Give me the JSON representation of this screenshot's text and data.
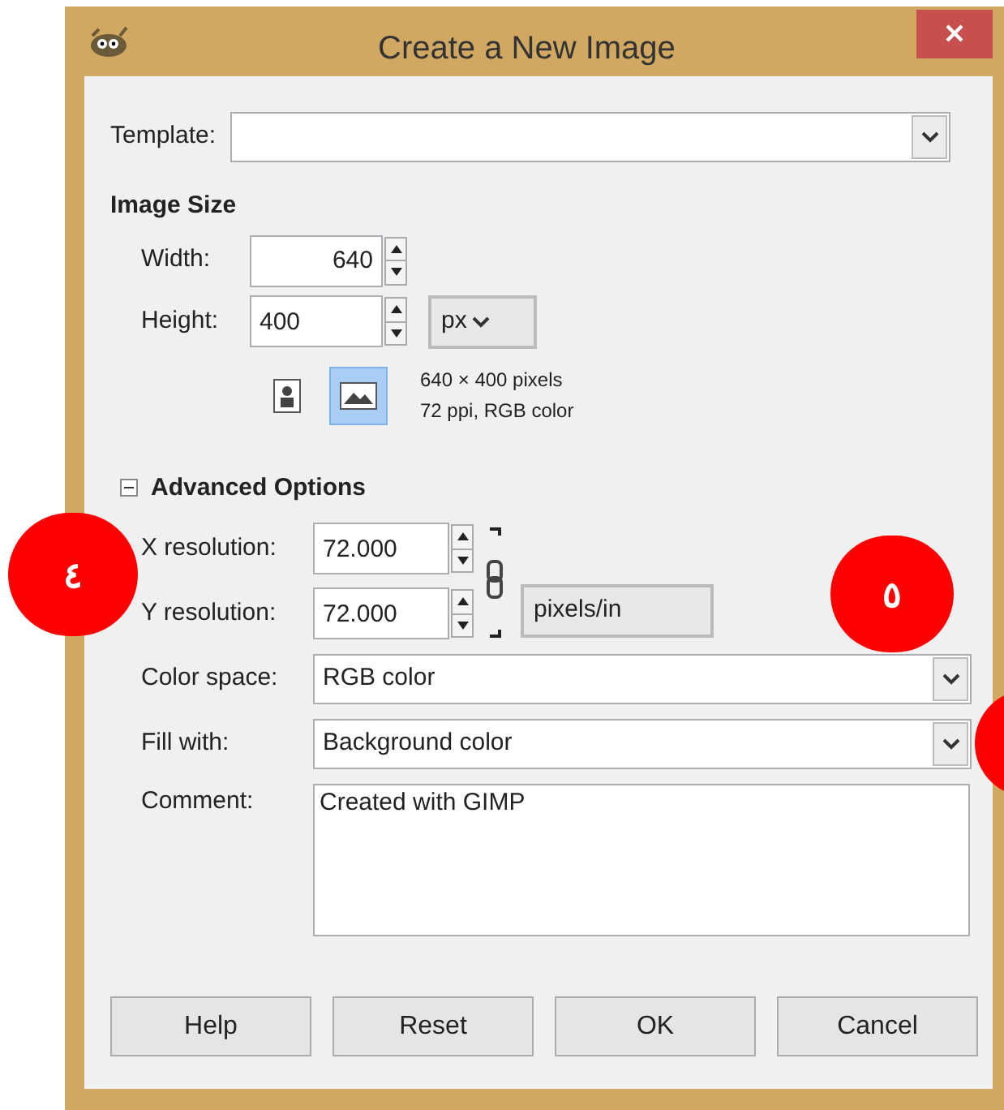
{
  "window": {
    "title": "Create a New Image"
  },
  "template": {
    "label": "Template:"
  },
  "image_size": {
    "heading": "Image Size",
    "width": {
      "label": "Width:",
      "value": "640"
    },
    "height": {
      "label": "Height:",
      "value": "400"
    },
    "unit": "px",
    "orientations": [
      {
        "kind": "portrait",
        "selected": false
      },
      {
        "kind": "landscape",
        "selected": true
      }
    ],
    "info": [
      "640 × 400 pixels",
      "72 ppi, RGB color"
    ]
  },
  "advanced": {
    "label": "Advanced Options",
    "expanded": true,
    "x_resolution": {
      "label": "X resolution:",
      "value": "72.000"
    },
    "y_resolution": {
      "label": "Y resolution:",
      "value": "72.000"
    },
    "resolution_unit": "pixels/in",
    "color_space": {
      "label": "Color space:",
      "value": "RGB color"
    },
    "fill_with": {
      "label": "Fill with:",
      "value": "Background color"
    },
    "comment": {
      "label": "Comment:",
      "value": "Created with GIMP"
    }
  },
  "buttons": [
    "Help",
    "Reset",
    "OK",
    "Cancel"
  ],
  "callouts": [
    {
      "kind": "numbered",
      "text": "٤"
    },
    {
      "kind": "numbered",
      "text": "٥"
    },
    {
      "kind": "cut-off"
    }
  ]
}
